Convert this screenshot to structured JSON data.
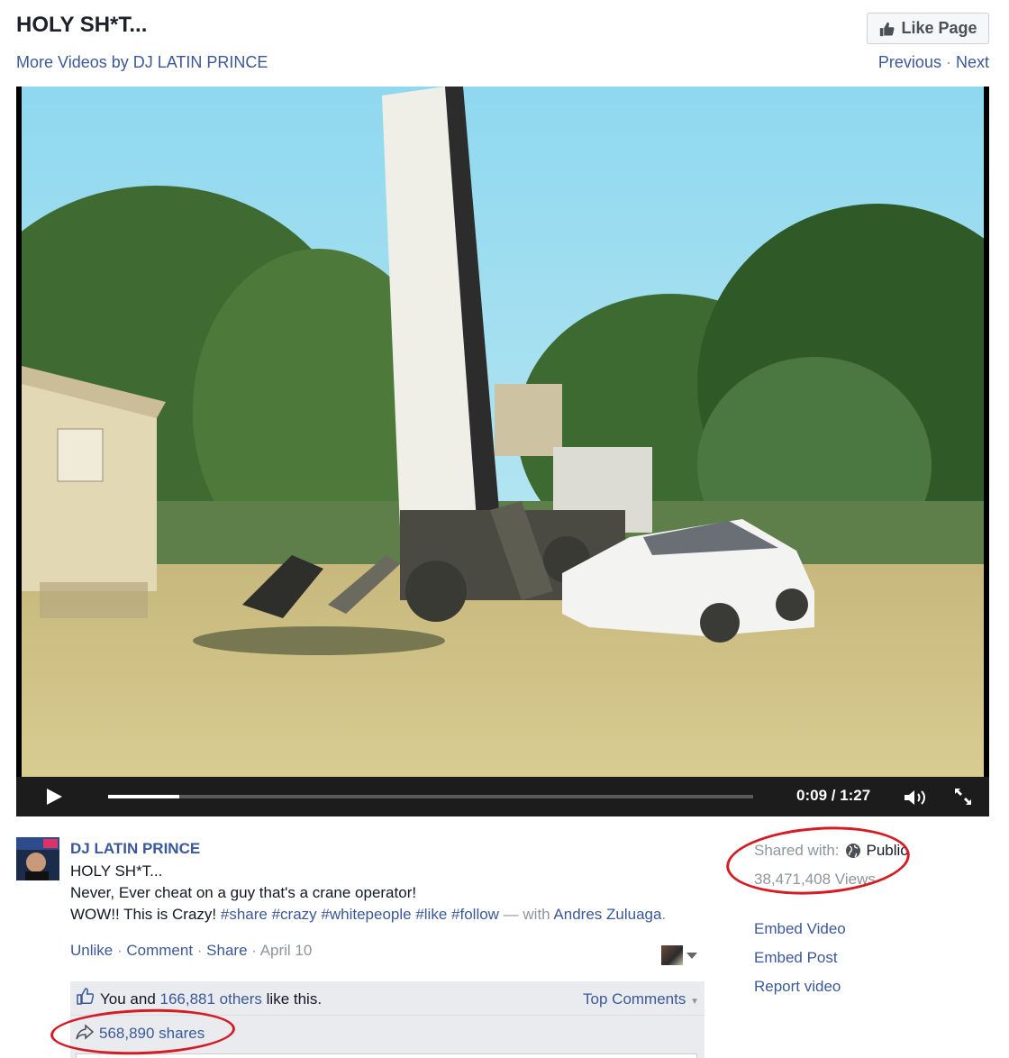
{
  "header": {
    "title": "HOLY SH*T...",
    "like_page_label": "Like Page",
    "more_videos_label": "More Videos by DJ LATIN PRINCE",
    "previous_label": "Previous",
    "separator": "·",
    "next_label": "Next"
  },
  "player": {
    "time": "0:09 / 1:27",
    "progress_fraction": 0.11
  },
  "post": {
    "author": "DJ LATIN PRINCE",
    "title": "HOLY SH*T...",
    "line1": "Never, Ever cheat on a guy that's a crane operator!",
    "line2_prefix": "WOW!! This is Crazy! ",
    "hashtags": [
      "#share",
      "#crazy",
      "#whitepeople",
      "#like",
      "#follow"
    ],
    "with_text": " — with ",
    "with_name": "Andres Zuluaga",
    "with_end": ".",
    "actions": {
      "unlike": "Unlike",
      "comment": "Comment",
      "share": "Share",
      "date": "April 10",
      "sep": " · "
    }
  },
  "ufi": {
    "likes_prefix": "You and ",
    "likes_others": "166,881 others",
    "likes_suffix": " like this.",
    "top_comments": "Top Comments",
    "shares": "568,890 shares"
  },
  "sidebar": {
    "shared_with_label": "Shared with:",
    "audience": "Public",
    "views": "38,471,408 Views",
    "links": [
      "Embed Video",
      "Embed Post",
      "Report video"
    ]
  },
  "colors": {
    "link": "#3b5998",
    "annotation_red": "#d41c24",
    "muted": "#90949c"
  }
}
